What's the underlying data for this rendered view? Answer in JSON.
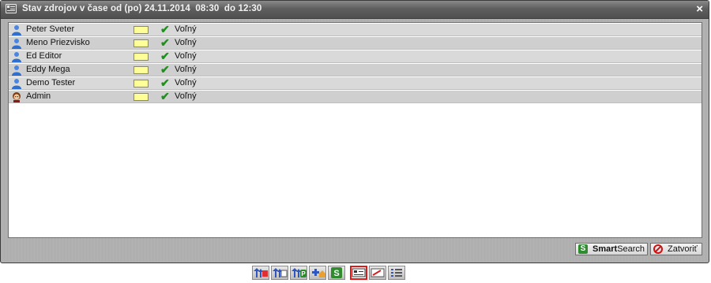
{
  "window": {
    "title": "Stav zdrojov v čase od (po) 24.11.2014  08:30  do 12:30",
    "close_symbol": "×"
  },
  "resources": [
    {
      "name": "Peter Sveter",
      "status": "Voľný",
      "check": "✔",
      "avatar": "user-blue"
    },
    {
      "name": "Meno Priezvisko",
      "status": "Voľný",
      "check": "✔",
      "avatar": "user-blue"
    },
    {
      "name": "Ed Editor",
      "status": "Voľný",
      "check": "✔",
      "avatar": "user-blue"
    },
    {
      "name": "Eddy Mega",
      "status": "Voľný",
      "check": "✔",
      "avatar": "user-blue"
    },
    {
      "name": "Demo Tester",
      "status": "Voľný",
      "check": "✔",
      "avatar": "user-blue"
    },
    {
      "name": "Admin",
      "status": "Voľný",
      "check": "✔",
      "avatar": "user-admin"
    }
  ],
  "colors": {
    "availability_swatch": "#ffff99",
    "check": "#1f8f1f",
    "user_blue": "#2f6fd0"
  },
  "footer": {
    "smartsearch_icon_letter": "S",
    "smartsearch_label_bold": "Smart",
    "smartsearch_label_rest": "Search",
    "close_label": "Zatvoriť"
  },
  "taskbar": {
    "items": [
      {
        "icon": "up-arrows-red-icon"
      },
      {
        "icon": "up-arrows-doc-icon"
      },
      {
        "icon": "up-arrows-parking-icon"
      },
      {
        "icon": "cross-house-icon"
      },
      {
        "icon": "smartsearch-s-icon"
      },
      {
        "icon": "resource-status-icon",
        "active": true
      },
      {
        "icon": "card-icon"
      },
      {
        "icon": "list-icon"
      }
    ]
  }
}
